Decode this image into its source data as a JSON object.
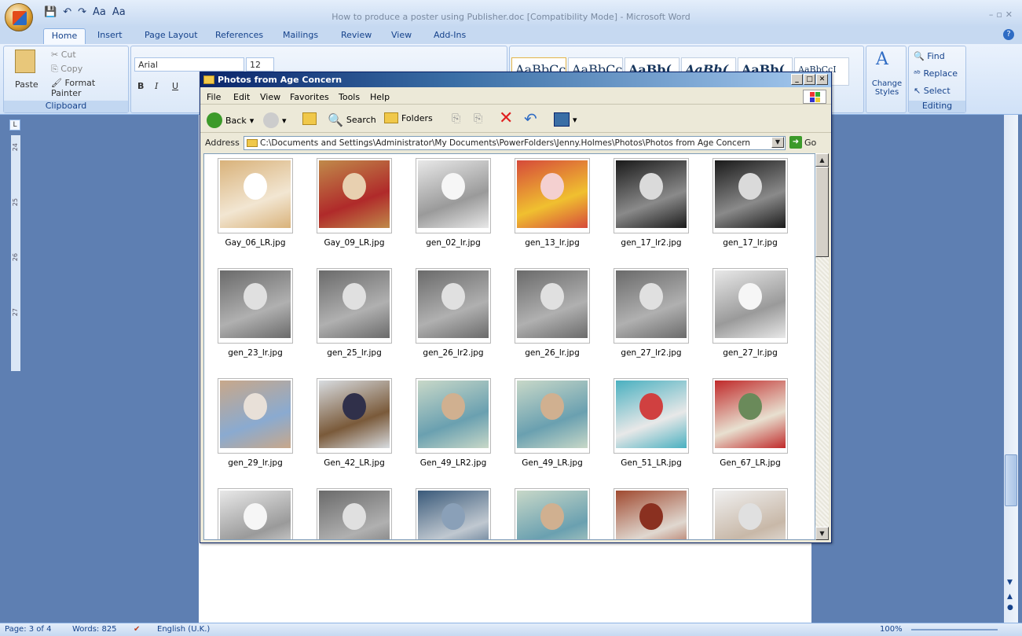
{
  "word": {
    "window_title": "How to produce a poster using Publisher.doc [Compatibility Mode] - Microsoft Word",
    "qat": [
      "💾",
      "↶",
      "↷",
      "Aa",
      "Aa"
    ],
    "tabs": [
      "Home",
      "Insert",
      "Page Layout",
      "References",
      "Mailings",
      "Review",
      "View",
      "Add-Ins"
    ],
    "clipboard": {
      "paste": "Paste",
      "cut": "Cut",
      "copy": "Copy",
      "format_painter": "Format Painter",
      "label": "Clipboard"
    },
    "font": {
      "name": "Arial",
      "size": "12",
      "bold": "B",
      "italic": "I",
      "underline": "U"
    },
    "styles": {
      "swatches": [
        "AaBbCc",
        "AaBbCc",
        "AaBb(",
        "AaBb(",
        "AaBb(",
        "AaBbCcI"
      ],
      "change_styles": "Change Styles"
    },
    "editing": {
      "find": "Find",
      "replace": "Replace",
      "select": "Select",
      "label": "Editing"
    },
    "ruler": [
      "24",
      "25",
      "26",
      "27"
    ],
    "status": {
      "page": "Page: 3 of 4",
      "words": "Words: 825",
      "language": "English (U.K.)",
      "zoom": "100%"
    }
  },
  "explorer": {
    "title": "Photos from Age Concern",
    "menu": [
      "File",
      "Edit",
      "View",
      "Favorites",
      "Tools",
      "Help"
    ],
    "toolbar": {
      "back": "Back",
      "search": "Search",
      "folders": "Folders"
    },
    "address_label": "Address",
    "address": "C:\\Documents and Settings\\Administrator\\My Documents\\PowerFolders\\Jenny.Holmes\\Photos\\Photos from Age Concern",
    "go": "Go",
    "files": [
      {
        "name": "Gay_06_LR.jpg",
        "tone": "color-warm"
      },
      {
        "name": "Gay_09_LR.jpg",
        "tone": "color-red"
      },
      {
        "name": "gen_02_lr.jpg",
        "tone": "bw-light"
      },
      {
        "name": "gen_13_lr.jpg",
        "tone": "color-yarn"
      },
      {
        "name": "gen_17_lr2.jpg",
        "tone": "bw-dark"
      },
      {
        "name": "gen_17_lr.jpg",
        "tone": "bw-dark"
      },
      {
        "name": "gen_23_lr.jpg",
        "tone": "bw-mid"
      },
      {
        "name": "gen_25_lr.jpg",
        "tone": "bw-mid"
      },
      {
        "name": "gen_26_lr2.jpg",
        "tone": "bw-mid"
      },
      {
        "name": "gen_26_lr.jpg",
        "tone": "bw-mid"
      },
      {
        "name": "gen_27_lr2.jpg",
        "tone": "bw-mid"
      },
      {
        "name": "gen_27_lr.jpg",
        "tone": "bw-light"
      },
      {
        "name": "gen_29_lr.jpg",
        "tone": "color-hand"
      },
      {
        "name": "Gen_42_LR.jpg",
        "tone": "color-bench"
      },
      {
        "name": "Gen_49_LR2.jpg",
        "tone": "color-group"
      },
      {
        "name": "Gen_49_LR.jpg",
        "tone": "color-group"
      },
      {
        "name": "Gen_51_LR.jpg",
        "tone": "color-teal"
      },
      {
        "name": "Gen_67_LR.jpg",
        "tone": "color-party"
      },
      {
        "name": "",
        "tone": "bw-light"
      },
      {
        "name": "",
        "tone": "bw-mid"
      },
      {
        "name": "",
        "tone": "color-blue"
      },
      {
        "name": "",
        "tone": "color-group"
      },
      {
        "name": "",
        "tone": "color-brick"
      },
      {
        "name": "",
        "tone": "color-pale"
      }
    ]
  }
}
